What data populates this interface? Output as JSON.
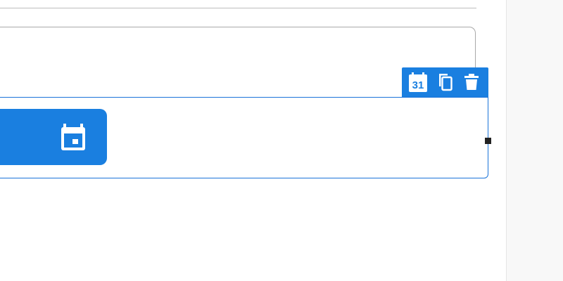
{
  "colors": {
    "accent": "#1a7fe0",
    "selection_border": "#1a73d9",
    "block_border": "#a8a8a8",
    "divider": "#bdbdbd",
    "handle": "#222222",
    "panel_bg": "#f8f8f8"
  },
  "toolbar": {
    "calendar_day": "31",
    "icons": [
      "calendar-31-icon",
      "copy-icon",
      "trash-icon"
    ]
  },
  "date_button": {
    "icon": "calendar-icon"
  }
}
